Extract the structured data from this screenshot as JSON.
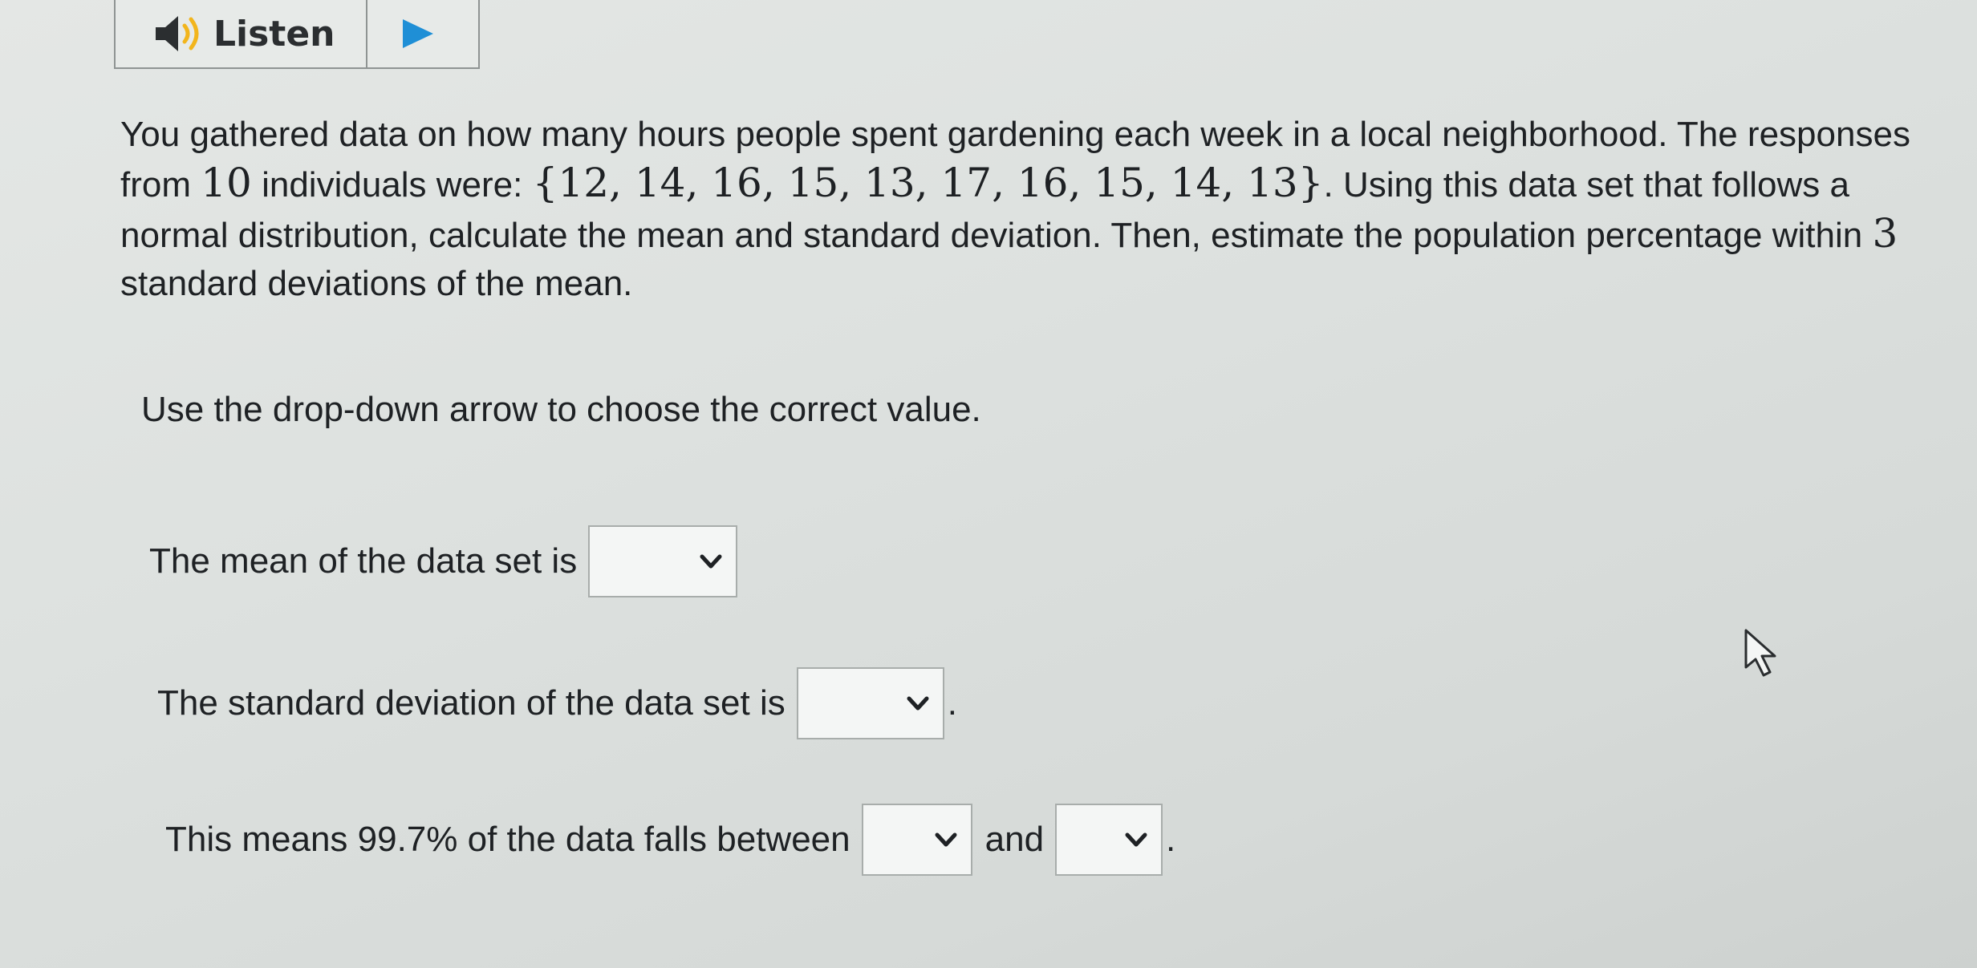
{
  "toolbar": {
    "listen_label": "Listen",
    "speaker_icon": "speaker-icon",
    "play_icon": "play-icon"
  },
  "question": {
    "text_part1": "You gathered data on how many hours people spent gardening each week in a local neighborhood. The responses from ",
    "count": "10",
    "text_part2": " individuals were: ",
    "dataset": "{12, 14, 16, 15, 13, 17, 16, 15, 14, 13}",
    "text_part3": ". Using this data set that follows a normal distribution, calculate the mean and standard deviation. Then, estimate the population percentage within ",
    "num_sd": "3",
    "text_part4": " standard deviations of the mean."
  },
  "instruction": "Use the drop-down arrow to choose the correct value.",
  "mean_prompt": "The mean of the data set is",
  "sd_prompt": "The standard deviation of the data set is",
  "period": ".",
  "range_prompt": "This means 99.7% of the data falls between",
  "and_label": "and",
  "dropdowns": {
    "mean_value": "",
    "sd_value": "",
    "lower_value": "",
    "upper_value": ""
  },
  "colors": {
    "background": "#dde1df",
    "text": "#1e2124",
    "border": "#a8adab",
    "dropdown_bg": "#f4f6f5"
  }
}
